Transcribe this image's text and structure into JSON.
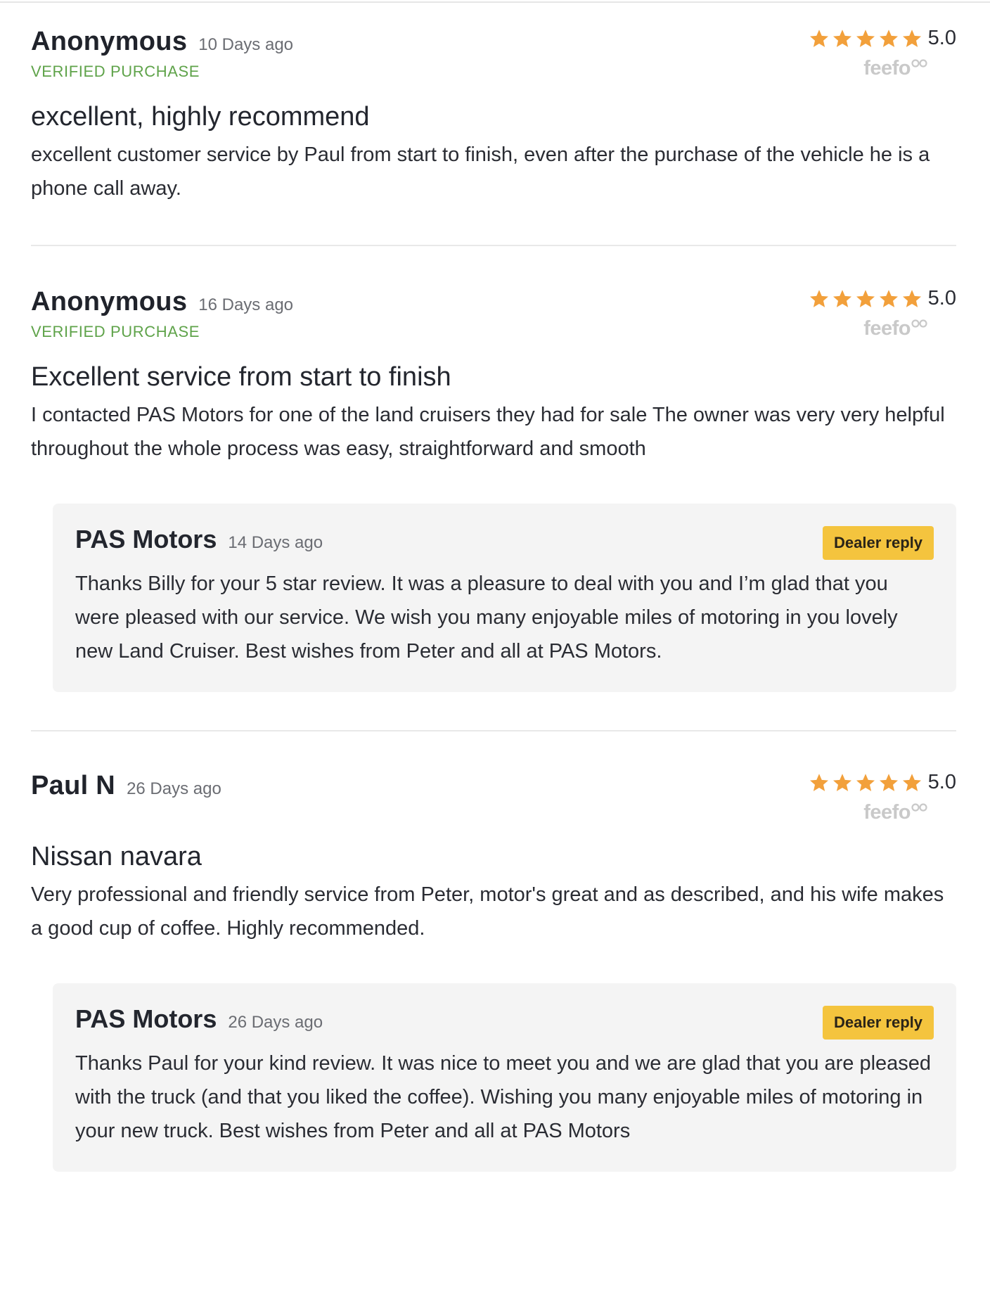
{
  "reviews": [
    {
      "reviewer": "Anonymous",
      "date": "10 Days ago",
      "verified": "VERIFIED PURCHASE",
      "rating": 5,
      "score": "5.0",
      "source": "feefo",
      "title": "excellent, highly recommend",
      "body": "excellent customer service by Paul from start to finish, even after the purchase of the vehicle he is a phone call away."
    },
    {
      "reviewer": "Anonymous",
      "date": "16 Days ago",
      "verified": "VERIFIED PURCHASE",
      "rating": 5,
      "score": "5.0",
      "source": "feefo",
      "title": "Excellent service from start to finish",
      "body": "I contacted PAS Motors for one of the land cruisers they had for sale The owner was very very helpful throughout the whole process was easy, straightforward and smooth",
      "reply": {
        "name": "PAS Motors",
        "date": "14 Days ago",
        "badge": "Dealer reply",
        "text": "Thanks Billy for your 5 star review. It was a pleasure to deal with you and I’m glad that you were pleased with our service. We wish you many enjoyable miles of motoring in you lovely new Land Cruiser. Best wishes from Peter and all at PAS Motors."
      }
    },
    {
      "reviewer": "Paul N",
      "date": "26 Days ago",
      "rating": 5,
      "score": "5.0",
      "source": "feefo",
      "title": "Nissan navara",
      "body": "Very professional and friendly service from Peter, motor's great and as described, and his wife makes a good cup of coffee. Highly recommended.",
      "reply": {
        "name": "PAS Motors",
        "date": "26 Days ago",
        "badge": "Dealer reply",
        "text": "Thanks Paul for your kind review. It was nice to meet you and we are glad that you are pleased with the truck (and that you liked the coffee). Wishing you many enjoyable miles of motoring in your new truck. Best wishes from Peter and all at PAS Motors"
      }
    }
  ],
  "colors": {
    "star": "#f2a03b",
    "verified": "#5fa34a",
    "badge": "#f4c43e",
    "reply_bg": "#f4f4f4",
    "feefo": "#c9c9c9"
  }
}
